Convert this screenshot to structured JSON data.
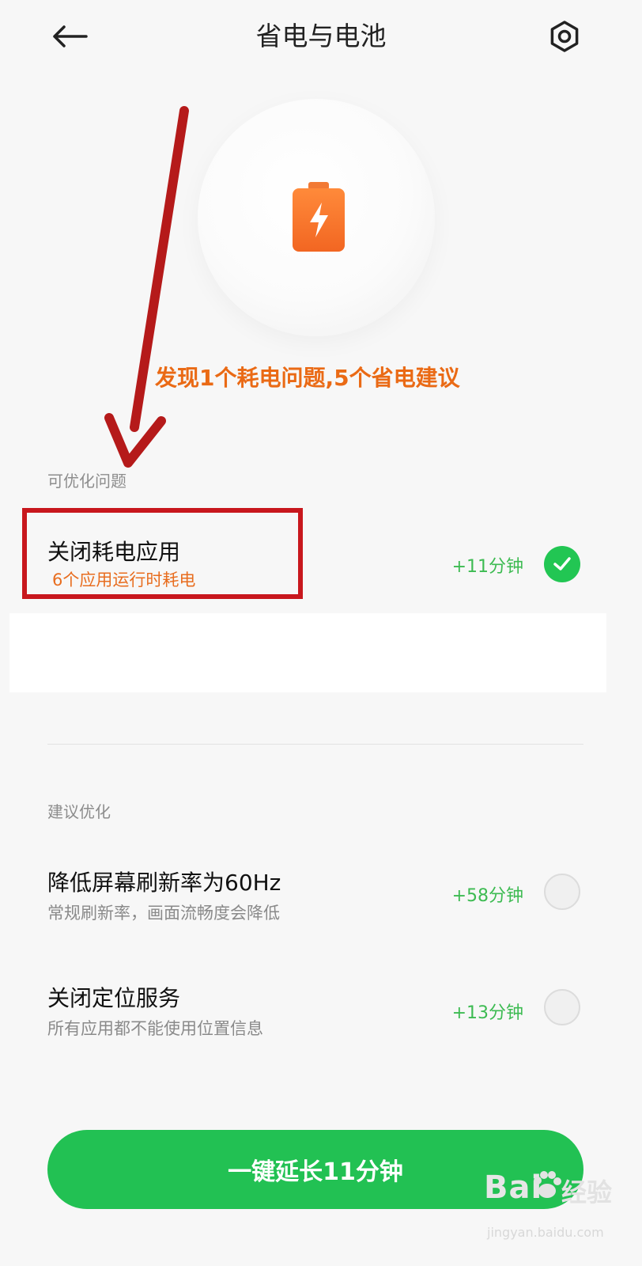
{
  "header": {
    "title": "省电与电池"
  },
  "summary": {
    "text": "发现1个耗电问题,5个省电建议"
  },
  "issues_section": {
    "label": "可优化问题",
    "items": [
      {
        "title": "关闭耗电应用",
        "subtitle": "6个应用运行时耗电",
        "gain": "+11分钟",
        "checked": true
      }
    ]
  },
  "suggestions_section": {
    "label": "建议优化",
    "items": [
      {
        "title": "降低屏幕刷新率为60Hz",
        "subtitle": "常规刷新率，画面流畅度会降低",
        "gain": "+58分钟",
        "checked": false
      },
      {
        "title": "关闭定位服务",
        "subtitle": "所有应用都不能使用位置信息",
        "gain": "+13分钟",
        "checked": false
      }
    ]
  },
  "action": {
    "button_label": "一键延长11分钟"
  },
  "watermark": {
    "brand": "Bai",
    "brand2": "经验",
    "domain": "jingyan.baidu.com"
  },
  "colors": {
    "accent_green": "#22c153",
    "warning_orange": "#ea6a15",
    "annotation_red": "#c8171d"
  }
}
